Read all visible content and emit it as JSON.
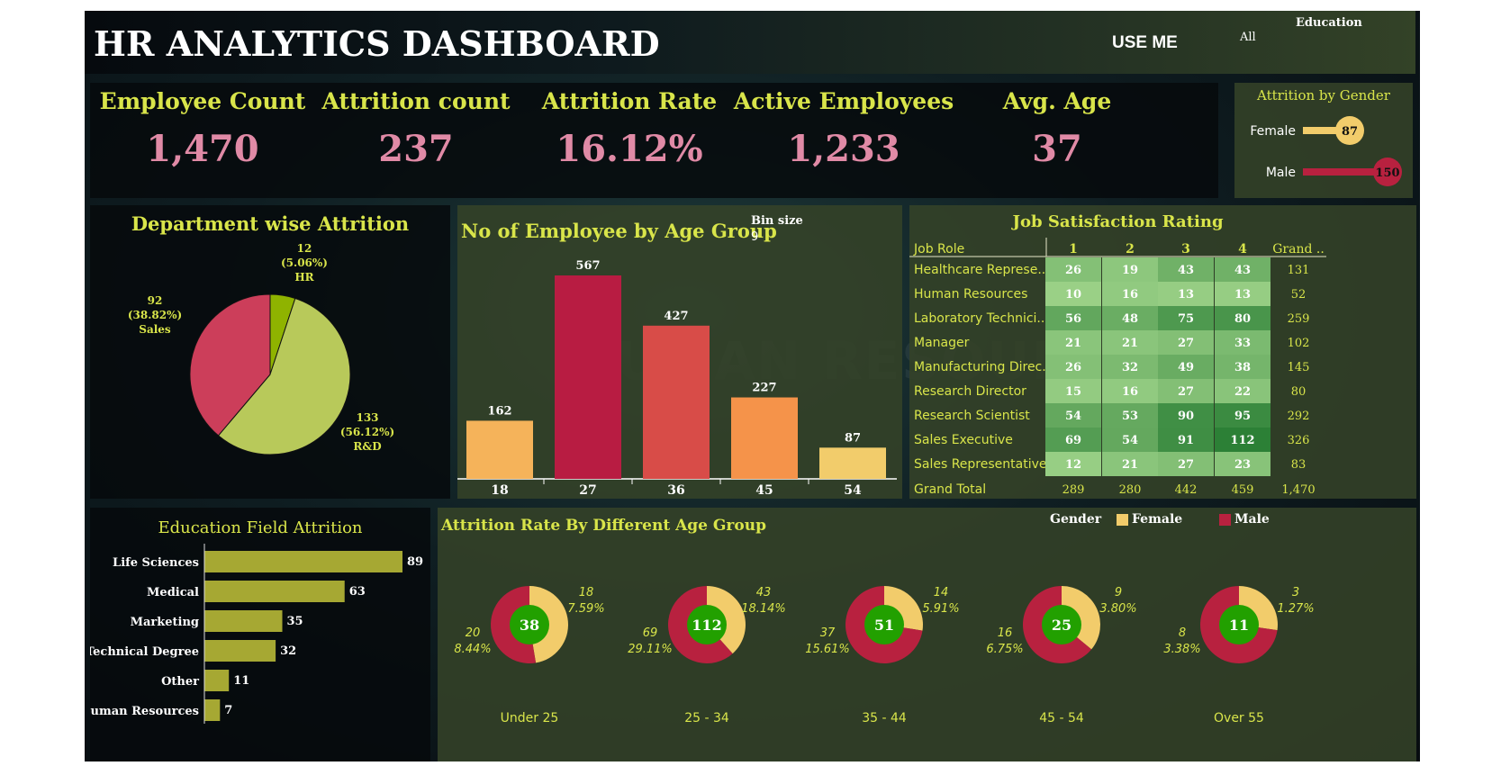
{
  "header": {
    "title": "HR ANALYTICS DASHBOARD",
    "use_me": "USE ME",
    "filter_label": "Education",
    "filter_value": "All"
  },
  "kpis": [
    {
      "label": "Employee Count",
      "value": "1,470"
    },
    {
      "label": "Attrition count",
      "value": "237"
    },
    {
      "label": "Attrition Rate",
      "value": "16.12%"
    },
    {
      "label": "Active Employees",
      "value": "1,233"
    },
    {
      "label": "Avg. Age",
      "value": "37"
    }
  ],
  "panels": {
    "gender": "Attrition by Gender",
    "department": "Department wise Attrition",
    "age_group": "No of Employee by Age Group",
    "bin_size_label": "Bin size",
    "bin_size_value": "9",
    "job_satisfaction": "Job Satisfaction Rating",
    "education": "Education Field Attrition",
    "attrition_age": "Attrition Rate By Different Age Group",
    "legend_title": "Gender",
    "legend_female": "Female",
    "legend_male": "Male"
  },
  "colors": {
    "female": "#f2cc6b",
    "male": "#b8213f",
    "accent_text": "#d9e54a",
    "kpi_value": "#e08aa6",
    "donut_center": "#22a000",
    "education_bar": "#a6a833"
  },
  "chart_data": [
    {
      "type": "bar",
      "title": "Attrition by Gender",
      "categories": [
        "Female",
        "Male"
      ],
      "values": [
        87,
        150
      ]
    },
    {
      "type": "pie",
      "title": "Department wise Attrition",
      "slices": [
        {
          "label": "HR",
          "value": 12,
          "percent": "5.06%",
          "color": "#8fb300"
        },
        {
          "label": "R&D",
          "value": 133,
          "percent": "56.12%",
          "color": "#b8c95a"
        },
        {
          "label": "Sales",
          "value": 92,
          "percent": "38.82%",
          "color": "#cc3e5a"
        }
      ]
    },
    {
      "type": "bar",
      "title": "No of Employee by Age Group",
      "categories": [
        "18",
        "27",
        "36",
        "45",
        "54"
      ],
      "values": [
        162,
        567,
        427,
        227,
        87
      ],
      "colors": [
        "#f5b35a",
        "#b81c42",
        "#d84c48",
        "#f5934a",
        "#f2cc6b"
      ],
      "ylim": [
        0,
        567
      ]
    },
    {
      "type": "table",
      "title": "Job Satisfaction Rating",
      "columns": [
        "Job Role",
        "1",
        "2",
        "3",
        "4",
        "Grand .."
      ],
      "rows": [
        {
          "role": "Healthcare Represe..",
          "values": [
            26,
            19,
            43,
            43
          ],
          "total": "131"
        },
        {
          "role": "Human Resources",
          "values": [
            10,
            16,
            13,
            13
          ],
          "total": "52"
        },
        {
          "role": "Laboratory Technici..",
          "values": [
            56,
            48,
            75,
            80
          ],
          "total": "259"
        },
        {
          "role": "Manager",
          "values": [
            21,
            21,
            27,
            33
          ],
          "total": "102"
        },
        {
          "role": "Manufacturing Direc..",
          "values": [
            26,
            32,
            49,
            38
          ],
          "total": "145"
        },
        {
          "role": "Research Director",
          "values": [
            15,
            16,
            27,
            22
          ],
          "total": "80"
        },
        {
          "role": "Research Scientist",
          "values": [
            54,
            53,
            90,
            95
          ],
          "total": "292"
        },
        {
          "role": "Sales Executive",
          "values": [
            69,
            54,
            91,
            112
          ],
          "total": "326"
        },
        {
          "role": "Sales Representative",
          "values": [
            12,
            21,
            27,
            23
          ],
          "total": "83"
        }
      ],
      "grand_total": {
        "label": "Grand Total",
        "values": [
          "289",
          "280",
          "442",
          "459"
        ],
        "total": "1,470"
      }
    },
    {
      "type": "bar",
      "title": "Education Field Attrition",
      "categories": [
        "Life Sciences",
        "Medical",
        "Marketing",
        "Technical Degree",
        "Other",
        "Human Resources"
      ],
      "values": [
        89,
        63,
        35,
        32,
        11,
        7
      ],
      "ylim": [
        0,
        89
      ]
    },
    {
      "type": "pie",
      "title": "Attrition Rate By Different Age Group",
      "groups": [
        {
          "label": "Under 25",
          "total": 38,
          "female": 18,
          "female_pct": "7.59%",
          "male": 20,
          "male_pct": "8.44%"
        },
        {
          "label": "25 - 34",
          "total": 112,
          "female": 43,
          "female_pct": "18.14%",
          "male": 69,
          "male_pct": "29.11%"
        },
        {
          "label": "35 - 44",
          "total": 51,
          "female": 14,
          "female_pct": "5.91%",
          "male": 37,
          "male_pct": "15.61%"
        },
        {
          "label": "45 - 54",
          "total": 25,
          "female": 9,
          "female_pct": "3.80%",
          "male": 16,
          "male_pct": "6.75%"
        },
        {
          "label": "Over 55",
          "total": 11,
          "female": 3,
          "female_pct": "1.27%",
          "male": 8,
          "male_pct": "3.38%"
        }
      ]
    }
  ]
}
